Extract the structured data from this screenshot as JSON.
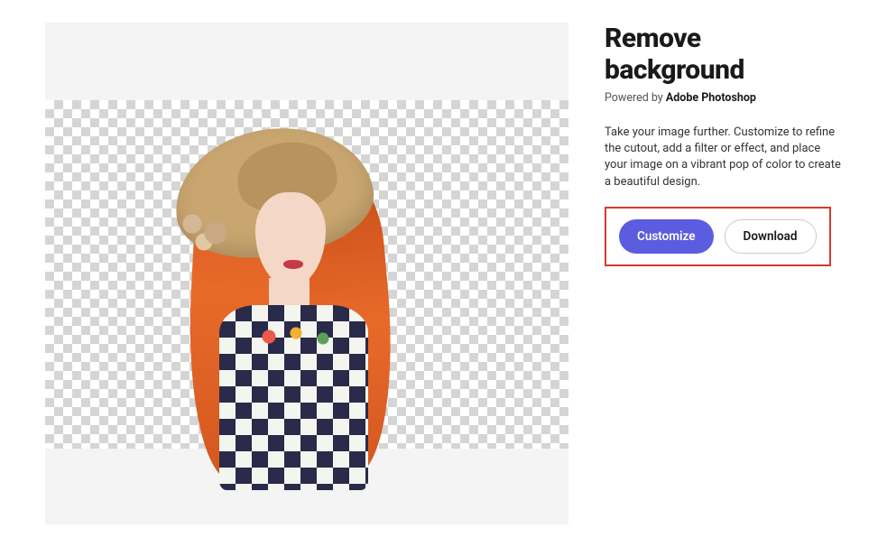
{
  "header": {
    "title": "Remove background",
    "powered_prefix": "Powered by ",
    "powered_product": "Adobe Photoshop"
  },
  "description": "Take your image further. Customize to refine the cutout, add a filter or effect, and place your image on a vibrant pop of color to create a beautiful design.",
  "actions": {
    "customize_label": "Customize",
    "download_label": "Download"
  }
}
